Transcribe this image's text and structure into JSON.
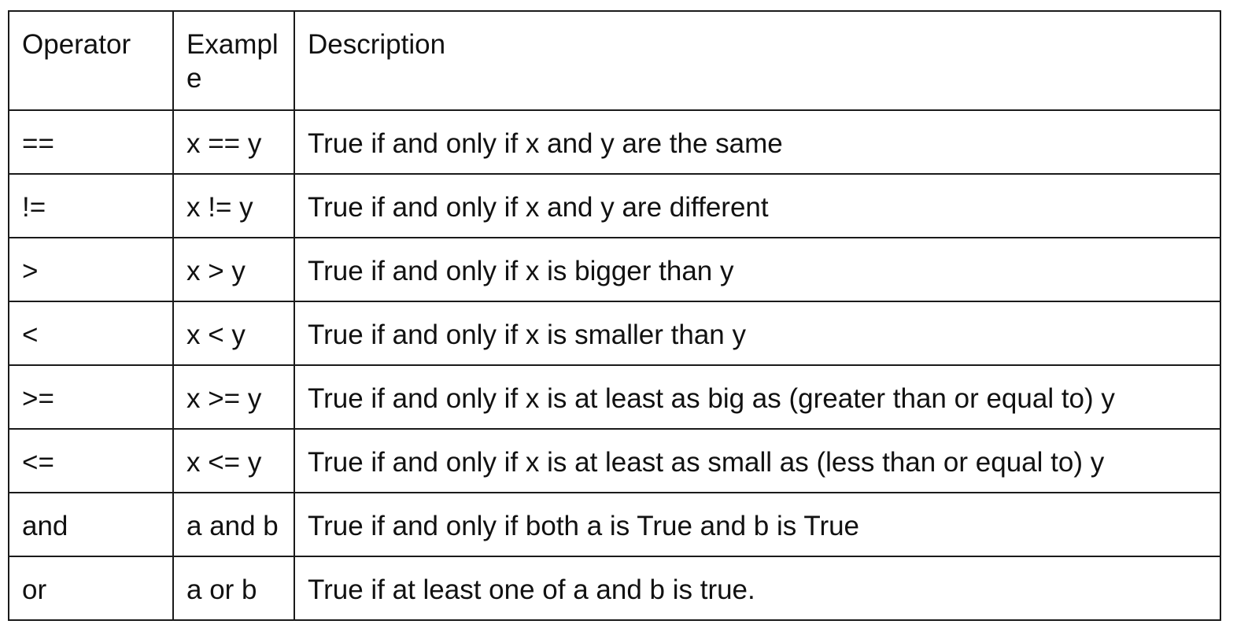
{
  "table": {
    "headers": [
      "Operator",
      "Example",
      "Description"
    ],
    "rows": [
      [
        "==",
        "x == y",
        "True if and only if x and y are the same"
      ],
      [
        "!=",
        "x != y",
        "True if and only if x and y are different"
      ],
      [
        ">",
        "x > y",
        "True if and only if x is bigger than y"
      ],
      [
        "<",
        "x < y",
        "True if and only if x is smaller than y"
      ],
      [
        ">=",
        "x >= y",
        "True if and only if x is at least as big as (greater than or equal to) y"
      ],
      [
        "<=",
        "x <= y",
        "True if and only if x is at least as small as (less than or equal to) y"
      ],
      [
        "and",
        "a and b",
        "True if and only if both a is True and b is True"
      ],
      [
        "or",
        "a or b",
        "True if at least one of a and b is true."
      ]
    ]
  }
}
